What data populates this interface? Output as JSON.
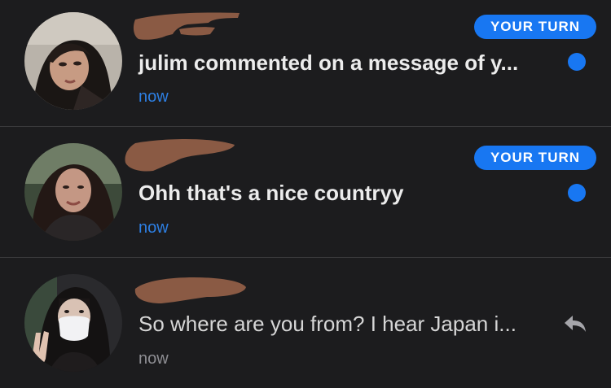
{
  "conversations": [
    {
      "badge": "YOUR TURN",
      "message": "julim commented on a message of y...",
      "time": "now",
      "status": "unread",
      "status_icon": "unread-dot-icon"
    },
    {
      "badge": "YOUR TURN",
      "message": "Ohh that's a nice countryy",
      "time": "now",
      "status": "unread",
      "status_icon": "unread-dot-icon"
    },
    {
      "badge": "",
      "message": "So where are you from? I hear Japan i...",
      "time": "now",
      "status": "read",
      "status_icon": "reply-arrow-icon"
    }
  ],
  "colors": {
    "background": "#1c1c1e",
    "accent": "#1877f2",
    "timestamp_unread": "#2d7fe3",
    "timestamp_read": "#8e8e93",
    "divider": "#3a3a3c"
  }
}
